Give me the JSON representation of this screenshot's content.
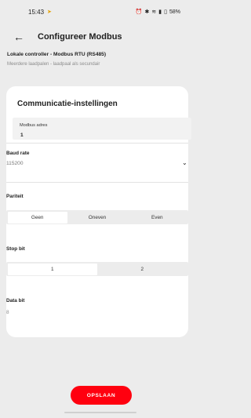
{
  "status_bar": {
    "time": "15:43",
    "battery": "58%",
    "icons": [
      "location-icon",
      "alarm-icon",
      "bluetooth-icon",
      "wifi-icon",
      "signal-icon",
      "battery-icon"
    ]
  },
  "header": {
    "title": "Configureer Modbus"
  },
  "controller": {
    "title": "Lokale controller - Modbus RTU (RS485)",
    "subtitle": "Meerdere laadpalen - laadpaal als secundair"
  },
  "settings": {
    "title": "Communicatie-instellingen",
    "modbus_address": {
      "label": "Modbus adres",
      "value": "1"
    },
    "baud_rate": {
      "label": "Baud rate",
      "value": "115200"
    },
    "parity": {
      "label": "Pariteit",
      "options": [
        "Geen",
        "Oneven",
        "Even"
      ],
      "selected": "Geen"
    },
    "stop_bit": {
      "label": "Stop bit",
      "options": [
        "1",
        "2"
      ],
      "selected": "1"
    },
    "data_bit": {
      "label": "Data bit",
      "value": "8"
    }
  },
  "actions": {
    "save_label": "OPSLAAN"
  },
  "colors": {
    "accent": "#ff000f",
    "background": "#ececec",
    "card": "#ffffff"
  }
}
